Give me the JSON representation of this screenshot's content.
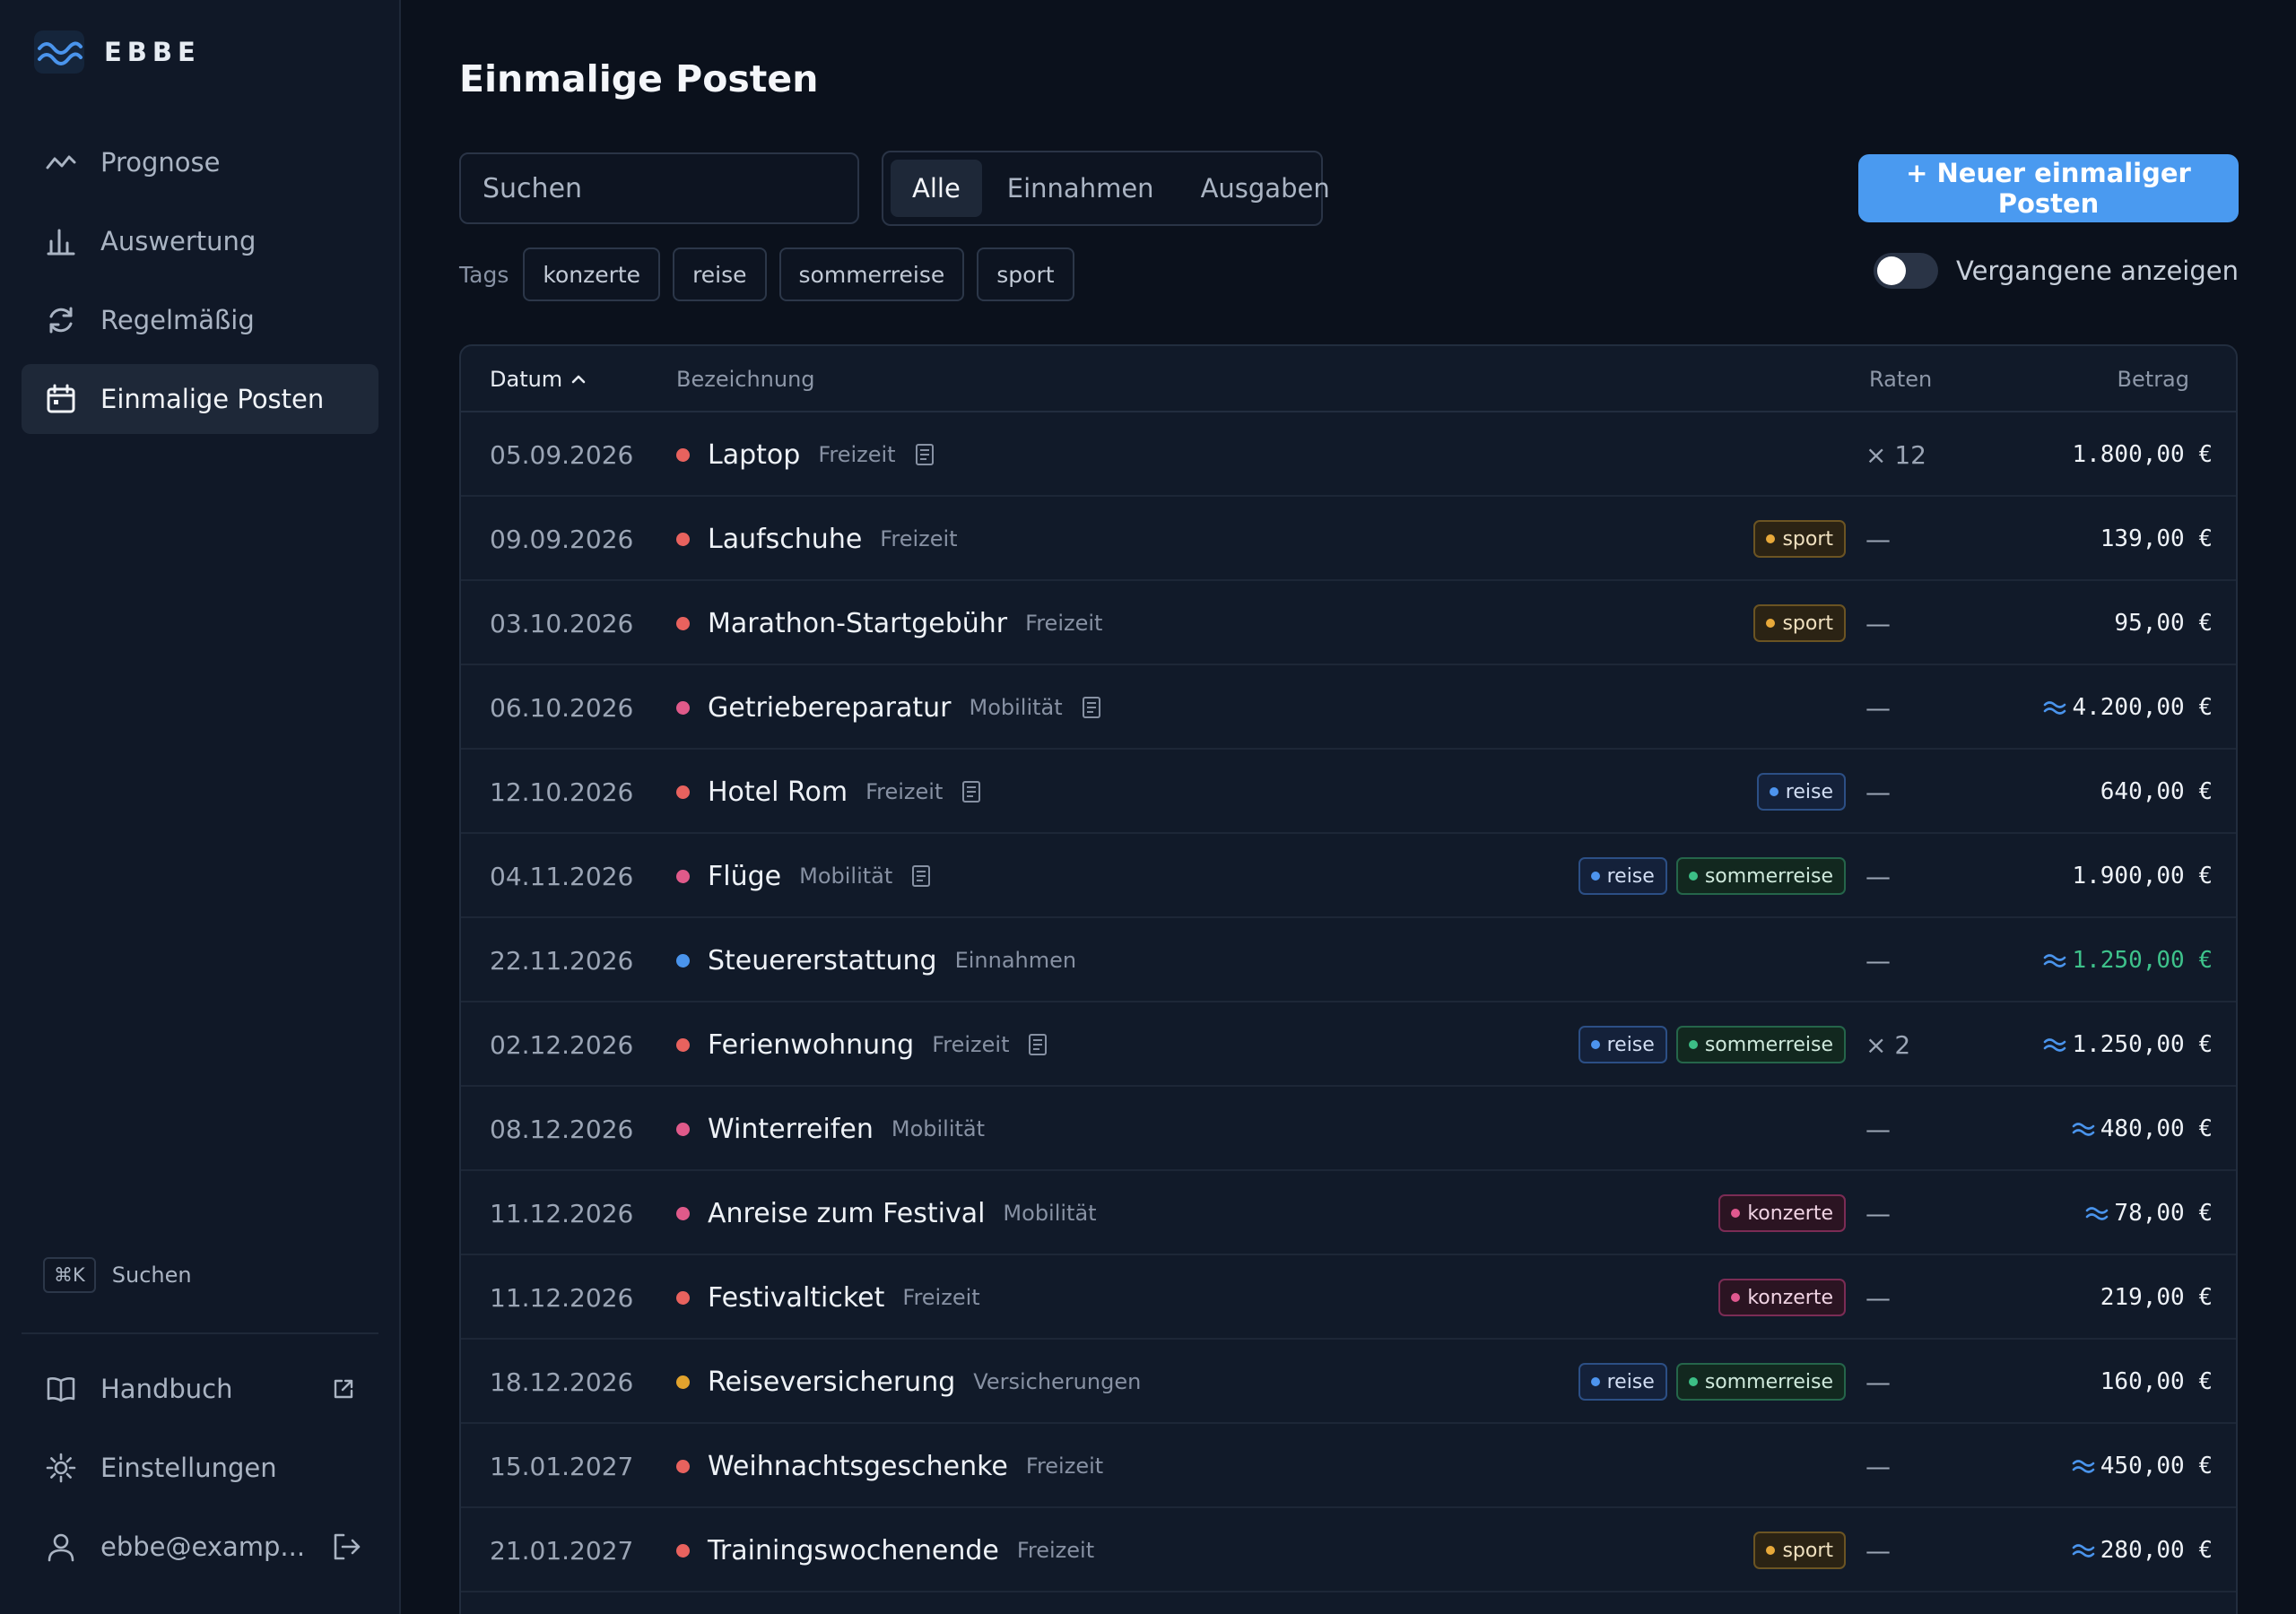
{
  "brand": {
    "name": "EBBE"
  },
  "nav": [
    {
      "label": "Prognose",
      "icon": "trend-icon",
      "active": false
    },
    {
      "label": "Auswertung",
      "icon": "bar-chart-icon",
      "active": false
    },
    {
      "label": "Regelmäßig",
      "icon": "refresh-icon",
      "active": false
    },
    {
      "label": "Einmalige Posten",
      "icon": "calendar-icon",
      "active": true
    }
  ],
  "quick_search": {
    "kbd": "⌘K",
    "label": "Suchen"
  },
  "footer_nav": [
    {
      "label": "Handbuch",
      "icon": "book-icon"
    },
    {
      "label": "Einstellungen",
      "icon": "gear-icon"
    },
    {
      "label": "ebbe@examp...",
      "icon": "user-icon"
    }
  ],
  "page": {
    "title": "Einmalige Posten"
  },
  "search": {
    "placeholder": "Suchen",
    "value": ""
  },
  "filter": {
    "options": [
      "Alle",
      "Einnahmen",
      "Ausgaben"
    ],
    "selected": "Alle"
  },
  "new_button": {
    "label": "+ Neuer einmaliger Posten"
  },
  "tags": {
    "label": "Tags",
    "items": [
      "konzerte",
      "reise",
      "sommerreise",
      "sport"
    ]
  },
  "toggle": {
    "label": "Vergangene anzeigen",
    "on": false
  },
  "table": {
    "headers": {
      "date": "Datum",
      "name": "Bezeichnung",
      "raten": "Raten",
      "betrag": "Betrag"
    },
    "colors": {
      "Freizeit": "#e8625e",
      "Mobilität": "#e05a8a",
      "Einnahmen": "#4a94ec",
      "Versicherungen": "#e2a32d"
    },
    "rows": [
      {
        "date": "05.09.2026",
        "name": "Laptop",
        "category": "Freizeit",
        "note": true,
        "tags": [],
        "raten": "× 12",
        "betrag": "1.800,00 €",
        "approx": false,
        "income": false
      },
      {
        "date": "09.09.2026",
        "name": "Laufschuhe",
        "category": "Freizeit",
        "note": false,
        "tags": [
          "sport"
        ],
        "raten": "—",
        "betrag": "139,00 €",
        "approx": false,
        "income": false
      },
      {
        "date": "03.10.2026",
        "name": "Marathon-Startgebühr",
        "category": "Freizeit",
        "note": false,
        "tags": [
          "sport"
        ],
        "raten": "—",
        "betrag": "95,00 €",
        "approx": false,
        "income": false
      },
      {
        "date": "06.10.2026",
        "name": "Getriebereparatur",
        "category": "Mobilität",
        "note": true,
        "tags": [],
        "raten": "—",
        "betrag": "4.200,00 €",
        "approx": true,
        "income": false
      },
      {
        "date": "12.10.2026",
        "name": "Hotel Rom",
        "category": "Freizeit",
        "note": true,
        "tags": [
          "reise"
        ],
        "raten": "—",
        "betrag": "640,00 €",
        "approx": false,
        "income": false
      },
      {
        "date": "04.11.2026",
        "name": "Flüge",
        "category": "Mobilität",
        "note": true,
        "tags": [
          "reise",
          "sommerreise"
        ],
        "raten": "—",
        "betrag": "1.900,00 €",
        "approx": false,
        "income": false
      },
      {
        "date": "22.11.2026",
        "name": "Steuererstattung",
        "category": "Einnahmen",
        "note": false,
        "tags": [],
        "raten": "—",
        "betrag": "1.250,00 €",
        "approx": true,
        "income": true
      },
      {
        "date": "02.12.2026",
        "name": "Ferienwohnung",
        "category": "Freizeit",
        "note": true,
        "tags": [
          "reise",
          "sommerreise"
        ],
        "raten": "× 2",
        "betrag": "1.250,00 €",
        "approx": true,
        "income": false
      },
      {
        "date": "08.12.2026",
        "name": "Winterreifen",
        "category": "Mobilität",
        "note": false,
        "tags": [],
        "raten": "—",
        "betrag": "480,00 €",
        "approx": true,
        "income": false
      },
      {
        "date": "11.12.2026",
        "name": "Anreise zum Festival",
        "category": "Mobilität",
        "note": false,
        "tags": [
          "konzerte"
        ],
        "raten": "—",
        "betrag": "78,00 €",
        "approx": true,
        "income": false
      },
      {
        "date": "11.12.2026",
        "name": "Festivalticket",
        "category": "Freizeit",
        "note": false,
        "tags": [
          "konzerte"
        ],
        "raten": "—",
        "betrag": "219,00 €",
        "approx": false,
        "income": false
      },
      {
        "date": "18.12.2026",
        "name": "Reiseversicherung",
        "category": "Versicherungen",
        "note": false,
        "tags": [
          "reise",
          "sommerreise"
        ],
        "raten": "—",
        "betrag": "160,00 €",
        "approx": false,
        "income": false
      },
      {
        "date": "15.01.2027",
        "name": "Weihnachtsgeschenke",
        "category": "Freizeit",
        "note": false,
        "tags": [],
        "raten": "—",
        "betrag": "450,00 €",
        "approx": true,
        "income": false
      },
      {
        "date": "21.01.2027",
        "name": "Trainingswochenende",
        "category": "Freizeit",
        "note": false,
        "tags": [
          "sport"
        ],
        "raten": "—",
        "betrag": "280,00 €",
        "approx": true,
        "income": false
      }
    ]
  }
}
